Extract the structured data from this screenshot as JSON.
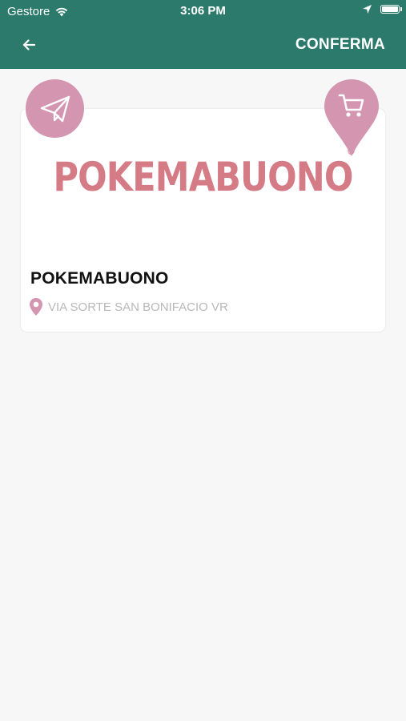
{
  "status_bar": {
    "carrier": "Gestore",
    "time": "3:06 PM"
  },
  "nav": {
    "confirm_label": "CONFERMA"
  },
  "store": {
    "logo_text": "POKEMABUONO",
    "logo_reg": "®",
    "name": "POKEMABUONO",
    "address": "VIA SORTE SAN BONIFACIO VR"
  },
  "colors": {
    "header": "#2b7a6b",
    "accent_pink": "#d495b0",
    "logo": "#d47b85"
  }
}
